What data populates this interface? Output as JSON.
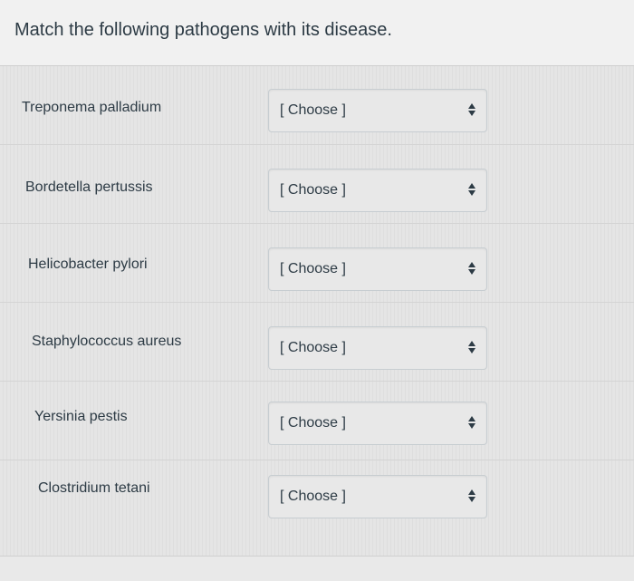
{
  "question": {
    "text": "Match the following pathogens with its disease."
  },
  "rows": [
    {
      "pathogen": "Treponema palladium",
      "selected": "[ Choose ]"
    },
    {
      "pathogen": "Bordetella pertussis",
      "selected": "[ Choose ]"
    },
    {
      "pathogen": "Helicobacter pylori",
      "selected": "[ Choose ]"
    },
    {
      "pathogen": "Staphylococcus aureus",
      "selected": "[ Choose ]"
    },
    {
      "pathogen": "Yersinia pestis",
      "selected": "[ Choose ]"
    },
    {
      "pathogen": "Clostridium tetani",
      "selected": "[ Choose ]"
    }
  ]
}
